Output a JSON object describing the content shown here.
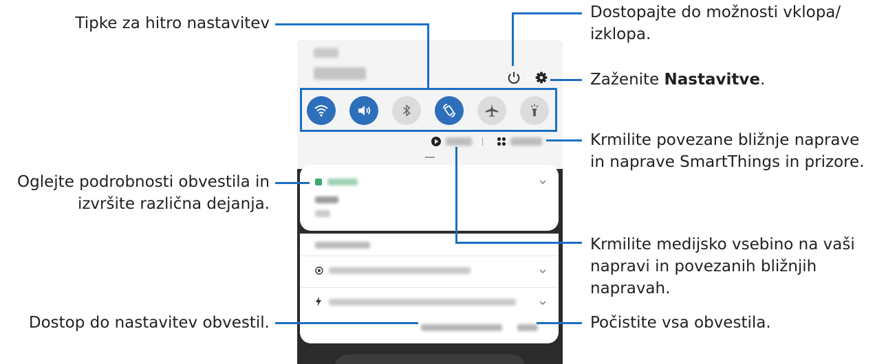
{
  "callouts": {
    "quick_settings": "Tipke za hitro nastavitev",
    "power_line1": "Dostopajte do možnosti vklopa/",
    "power_line2": "izklopa.",
    "settings_prefix": "Zaženite ",
    "settings_bold": "Nastavitve",
    "settings_suffix": ".",
    "smartthings_line1": "Krmilite povezane bližnje naprave",
    "smartthings_line2": "in naprave SmartThings in prizore.",
    "notif_line1": "Oglejte podrobnosti obvestila in",
    "notif_line2": "izvršite različna dejanja.",
    "media_line1": "Krmilite medijsko vsebino na vaši",
    "media_line2": "napravi in povezanih bližnjih",
    "media_line3": "napravah.",
    "notif_settings": "Dostop do nastavitev obvestil.",
    "clear": "Počistite vsa obvestila."
  },
  "quick_settings_buttons": [
    {
      "icon": "wifi-icon",
      "state": "on"
    },
    {
      "icon": "sound-icon",
      "state": "on"
    },
    {
      "icon": "bluetooth-icon",
      "state": "off"
    },
    {
      "icon": "auto-rotate-icon",
      "state": "on"
    },
    {
      "icon": "airplane-icon",
      "state": "off"
    },
    {
      "icon": "flashlight-icon",
      "state": "off"
    }
  ],
  "colors": {
    "accent_line": "#1a6fc4",
    "toggle_on": "#2d6fba",
    "calendar_green": "#3aa870"
  }
}
